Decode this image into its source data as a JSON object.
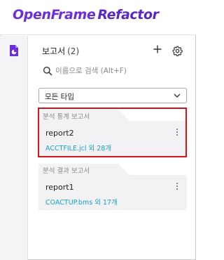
{
  "app": {
    "brand_part1": "OpenFrame",
    "brand_part2": "Refactor"
  },
  "rail": {
    "report_icon": "report-document-icon"
  },
  "panel": {
    "title": "보고서",
    "count": "(2)",
    "add_icon": "plus-icon",
    "settings_icon": "gear-icon"
  },
  "search": {
    "placeholder": "이름으로 검색 (Alt+F)",
    "value": ""
  },
  "filter": {
    "selected": "모든 타입"
  },
  "groups": [
    {
      "label": "분석 통계 보고서",
      "report": {
        "title": "report2",
        "subtitle": "ACCTFILE.jcl 외 28개"
      },
      "selected": true
    },
    {
      "label": "분석 결과 보고서",
      "report": {
        "title": "report1",
        "subtitle": "COACTUP.bms 외 17개"
      },
      "selected": false
    }
  ],
  "colors": {
    "brand": "#6b2fd9",
    "link": "#17a0c8",
    "selection": "#d4161c",
    "card_bg": "#f2f2f4"
  }
}
